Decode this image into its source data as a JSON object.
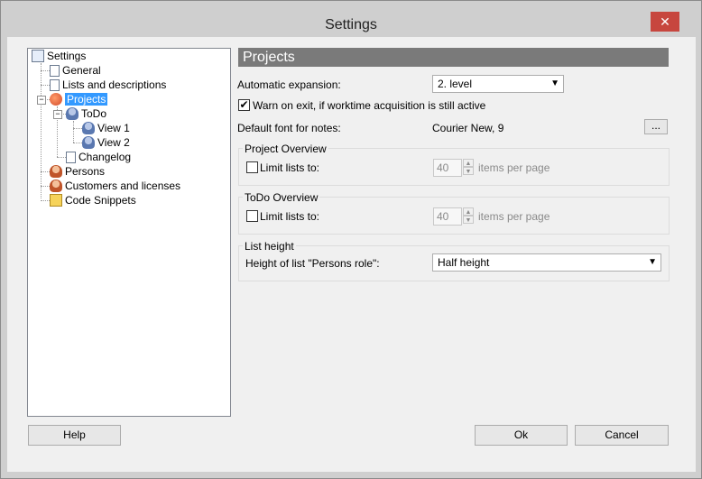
{
  "window": {
    "title": "Settings",
    "close_glyph": "✕"
  },
  "tree": {
    "root": "Settings",
    "general": "General",
    "lists": "Lists and descriptions",
    "projects": "Projects",
    "todo": "ToDo",
    "view1": "View 1",
    "view2": "View 2",
    "changelog": "Changelog",
    "persons": "Persons",
    "customers": "Customers and licenses",
    "snippets": "Code Snippets",
    "expander_minus": "−"
  },
  "panel": {
    "header": "Projects",
    "auto_expansion_label": "Automatic expansion:",
    "auto_expansion_value": "2. level",
    "warn_checked": true,
    "warn_label": "Warn on exit, if worktime acquisition is still active",
    "font_label": "Default font for notes:",
    "font_value": "Courier New, 9",
    "font_button": "...",
    "project_overview": {
      "title": "Project Overview",
      "limit_label": "Limit lists to:",
      "limit_checked": false,
      "count": "40",
      "unit": "items per page"
    },
    "todo_overview": {
      "title": "ToDo Overview",
      "limit_label": "Limit lists to:",
      "limit_checked": false,
      "count": "40",
      "unit": "items per page"
    },
    "list_height": {
      "title": "List height",
      "label": "Height of list \"Persons role\":",
      "value": "Half height"
    }
  },
  "buttons": {
    "help": "Help",
    "ok": "Ok",
    "cancel": "Cancel"
  },
  "glyphs": {
    "check": "✔",
    "dropdown": "▼",
    "spin_up": "▲",
    "spin_down": "▼"
  },
  "colors": {
    "selection": "#3399ff",
    "header_bg": "#7a7a7a",
    "close_bg": "#c7463e"
  }
}
